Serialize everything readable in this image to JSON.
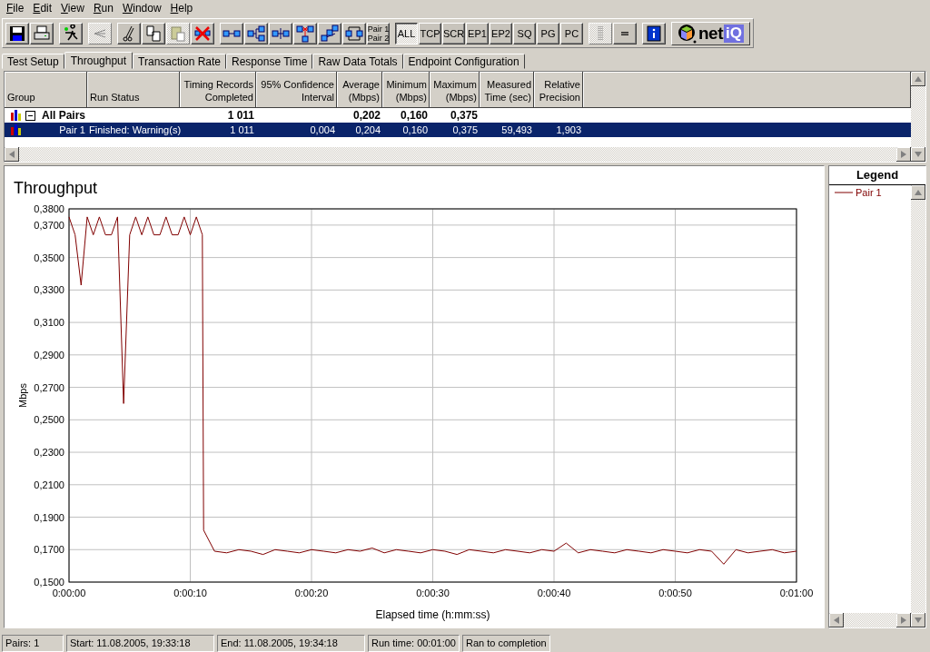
{
  "menu": [
    "File",
    "Edit",
    "View",
    "Run",
    "Window",
    "Help"
  ],
  "toolbar": {
    "groups": [
      [
        {
          "kind": "save",
          "disabled": false
        },
        {
          "kind": "print",
          "disabled": false
        }
      ],
      [
        {
          "kind": "run",
          "disabled": false
        }
      ],
      [
        {
          "kind": "swap",
          "disabled": true
        }
      ],
      [
        {
          "kind": "cut",
          "disabled": false
        },
        {
          "kind": "copy",
          "disabled": false
        },
        {
          "kind": "paste",
          "disabled": true
        },
        {
          "kind": "delete",
          "disabled": false
        }
      ],
      [
        {
          "kind": "pair",
          "disabled": false
        },
        {
          "kind": "branch",
          "disabled": false
        },
        {
          "kind": "merge",
          "disabled": false
        },
        {
          "kind": "broken",
          "disabled": false
        },
        {
          "kind": "mesh",
          "disabled": false
        },
        {
          "kind": "loop",
          "disabled": false
        },
        {
          "kind": "text",
          "lines": [
            "Pair 1",
            "Pair 2"
          ],
          "selected": false
        }
      ],
      [
        {
          "kind": "text",
          "lines": [
            "ALL"
          ],
          "selected": true
        },
        {
          "kind": "text",
          "lines": [
            "TCP"
          ],
          "selected": false
        },
        {
          "kind": "text",
          "lines": [
            "SCR"
          ],
          "selected": false
        },
        {
          "kind": "text",
          "lines": [
            "EP1"
          ],
          "selected": false
        },
        {
          "kind": "text",
          "lines": [
            "EP2"
          ],
          "selected": false
        },
        {
          "kind": "text",
          "lines": [
            "SQ"
          ],
          "selected": false
        },
        {
          "kind": "text",
          "lines": [
            "PG"
          ],
          "selected": false
        },
        {
          "kind": "text",
          "lines": [
            "PC"
          ],
          "selected": false
        }
      ],
      [
        {
          "kind": "dots",
          "disabled": true
        },
        {
          "kind": "lines",
          "disabled": false
        }
      ],
      [
        {
          "kind": "info",
          "disabled": false
        }
      ]
    ],
    "logo": {
      "text": "net",
      "accent": "iQ"
    }
  },
  "tabs": [
    {
      "label": "Test Setup",
      "selected": false
    },
    {
      "label": "Throughput",
      "selected": true
    },
    {
      "label": "Transaction Rate",
      "selected": false
    },
    {
      "label": "Response Time",
      "selected": false
    },
    {
      "label": "Raw Data Totals",
      "selected": false
    },
    {
      "label": "Endpoint Configuration",
      "selected": false
    }
  ],
  "table": {
    "columns": [
      {
        "lines": [
          "Group"
        ]
      },
      {
        "lines": [
          "Run Status"
        ]
      },
      {
        "lines": [
          "Timing Records",
          "Completed"
        ]
      },
      {
        "lines": [
          "95% Confidence",
          "Interval"
        ]
      },
      {
        "lines": [
          "Average",
          "(Mbps)"
        ]
      },
      {
        "lines": [
          "Minimum",
          "(Mbps)"
        ]
      },
      {
        "lines": [
          "Maximum",
          "(Mbps)"
        ]
      },
      {
        "lines": [
          "Measured",
          "Time (sec)"
        ]
      },
      {
        "lines": [
          "Relative",
          "Precision"
        ]
      }
    ],
    "rows": [
      {
        "kind": "group",
        "expanded": true,
        "selected": false,
        "cells": [
          "All Pairs",
          "",
          "1 011",
          "",
          "0,202",
          "0,160",
          "0,375",
          "",
          ""
        ]
      },
      {
        "kind": "pair",
        "selected": true,
        "cells": [
          "Pair 1",
          "Finished: Warning(s)",
          "1 011",
          "0,004",
          "0,204",
          "0,160",
          "0,375",
          "59,493",
          "1,903"
        ]
      }
    ]
  },
  "chart": {
    "chart_data": {
      "type": "line",
      "grid": true,
      "title": "Throughput",
      "xlabel": "Elapsed time (h:mm:ss)",
      "ylabel": "Mbps",
      "x": [
        0,
        0.5,
        1,
        1.5,
        2,
        2.5,
        3,
        3.5,
        4,
        4.5,
        5,
        5.5,
        6,
        6.5,
        7,
        7.5,
        8,
        8.5,
        9,
        9.5,
        10,
        10.5,
        11,
        11.1,
        12,
        13,
        14,
        15,
        16,
        17,
        18,
        19,
        20,
        21,
        22,
        23,
        24,
        25,
        26,
        27,
        28,
        29,
        30,
        31,
        32,
        33,
        34,
        35,
        36,
        37,
        38,
        39,
        40,
        41,
        42,
        43,
        44,
        45,
        46,
        47,
        48,
        49,
        50,
        51,
        52,
        53,
        54,
        55,
        56,
        57,
        58,
        59,
        60
      ],
      "series": [
        {
          "name": "Pair 1",
          "color": "#800000",
          "values": [
            0.375,
            0.364,
            0.333,
            0.375,
            0.364,
            0.375,
            0.364,
            0.364,
            0.375,
            0.26,
            0.364,
            0.375,
            0.364,
            0.375,
            0.364,
            0.364,
            0.375,
            0.364,
            0.364,
            0.375,
            0.364,
            0.375,
            0.364,
            0.182,
            0.169,
            0.168,
            0.17,
            0.169,
            0.167,
            0.17,
            0.169,
            0.168,
            0.17,
            0.169,
            0.168,
            0.17,
            0.169,
            0.171,
            0.168,
            0.17,
            0.169,
            0.168,
            0.17,
            0.169,
            0.167,
            0.17,
            0.169,
            0.168,
            0.17,
            0.169,
            0.168,
            0.17,
            0.169,
            0.174,
            0.168,
            0.17,
            0.169,
            0.168,
            0.17,
            0.169,
            0.168,
            0.17,
            0.169,
            0.168,
            0.17,
            0.169,
            0.161,
            0.17,
            0.168,
            0.169,
            0.17,
            0.168,
            0.169
          ]
        }
      ],
      "xlim": [
        0,
        60
      ],
      "ylim": [
        0.15,
        0.38
      ],
      "xticks": [
        {
          "value": 0,
          "label": "0:00:00"
        },
        {
          "value": 10,
          "label": "0:00:10"
        },
        {
          "value": 20,
          "label": "0:00:20"
        },
        {
          "value": 30,
          "label": "0:00:30"
        },
        {
          "value": 40,
          "label": "0:00:40"
        },
        {
          "value": 50,
          "label": "0:00:50"
        },
        {
          "value": 60,
          "label": "0:01:00"
        }
      ],
      "yticks": [
        {
          "value": 0.15,
          "label": "0,1500"
        },
        {
          "value": 0.17,
          "label": "0,1700"
        },
        {
          "value": 0.19,
          "label": "0,1900"
        },
        {
          "value": 0.21,
          "label": "0,2100"
        },
        {
          "value": 0.23,
          "label": "0,2300"
        },
        {
          "value": 0.25,
          "label": "0,2500"
        },
        {
          "value": 0.27,
          "label": "0,2700"
        },
        {
          "value": 0.29,
          "label": "0,2900"
        },
        {
          "value": 0.31,
          "label": "0,3100"
        },
        {
          "value": 0.33,
          "label": "0,3300"
        },
        {
          "value": 0.35,
          "label": "0,3500"
        },
        {
          "value": 0.37,
          "label": "0,3700"
        },
        {
          "value": 0.38,
          "label": "0,3800"
        }
      ]
    }
  },
  "legend": {
    "title": "Legend"
  },
  "status_bar": [
    "Pairs: 1",
    "Start: 11.08.2005, 19:33:18",
    "End: 11.08.2005, 19:34:18",
    "Run time: 00:01:00",
    "Ran to completion"
  ]
}
